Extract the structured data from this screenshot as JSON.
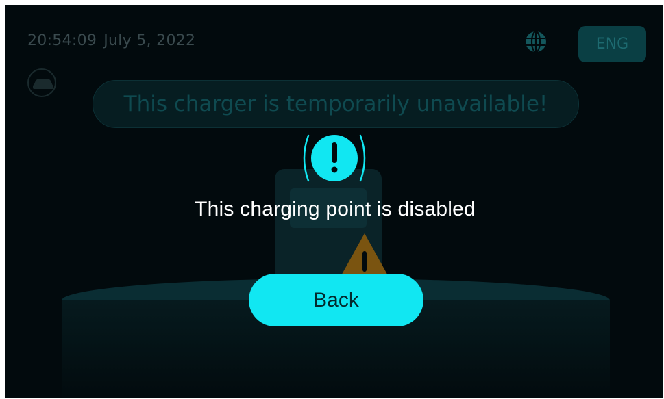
{
  "status_bar": {
    "time": "20:54:09",
    "date": "July 5, 2022",
    "globe_icon": "globe-icon",
    "language": "ENG"
  },
  "banner": {
    "text": "This charger is temporarily unavailable!"
  },
  "modal": {
    "icon": "exclamation-icon",
    "message": "This charging point is disabled",
    "back_label": "Back"
  },
  "colors": {
    "background": "#020a0d",
    "accent": "#11e7f2",
    "warning": "#c98a1a"
  }
}
